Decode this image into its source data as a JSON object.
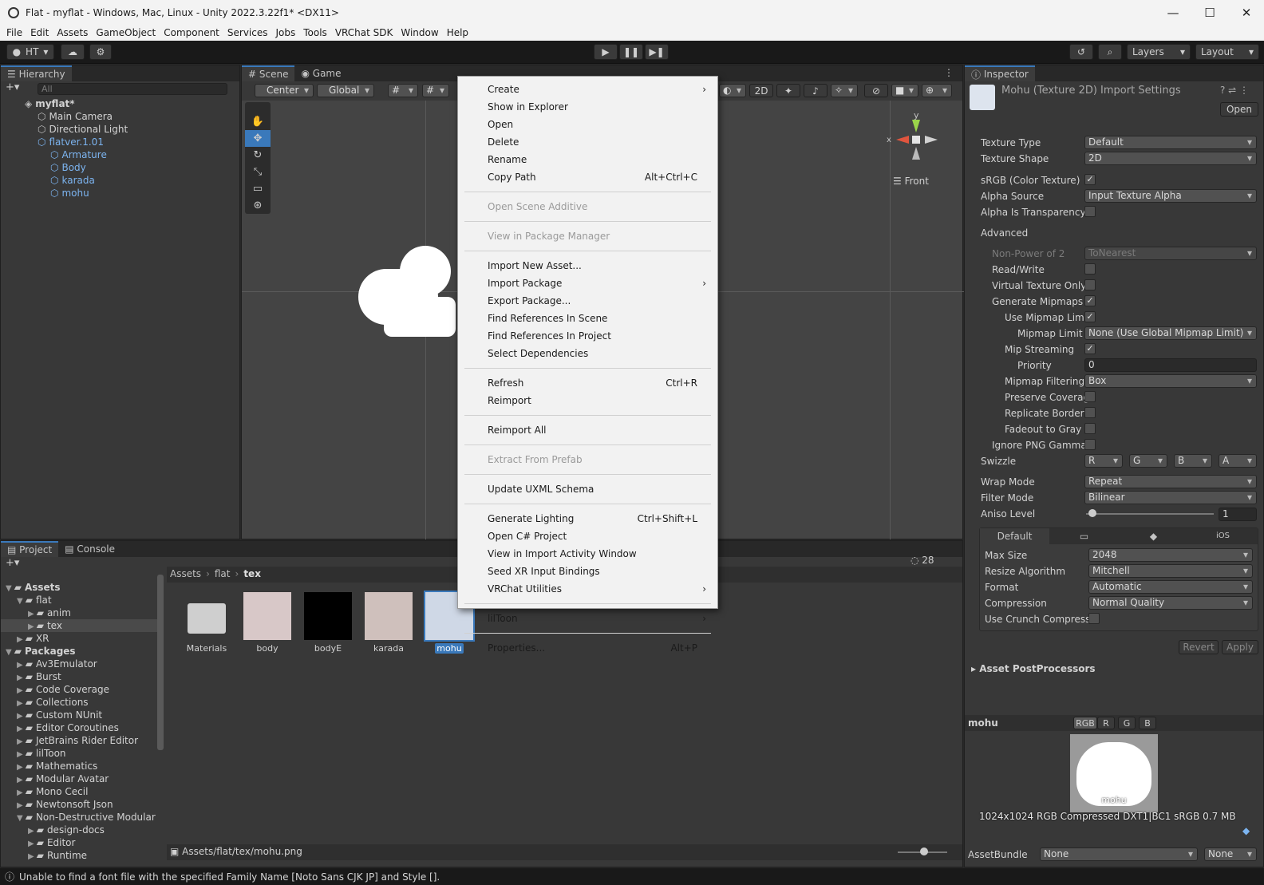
{
  "window": {
    "title": "Flat - myflat - Windows, Mac, Linux - Unity 2022.3.22f1* <DX11>"
  },
  "menubar": [
    "File",
    "Edit",
    "Assets",
    "GameObject",
    "Component",
    "Services",
    "Jobs",
    "Tools",
    "VRChat SDK",
    "Window",
    "Help"
  ],
  "toolbar": {
    "account": "HT",
    "layers": "Layers",
    "layout": "Layout"
  },
  "hierarchy": {
    "tab": "Hierarchy",
    "search_placeholder": "All",
    "items": [
      {
        "label": "myflat*",
        "depth": 0,
        "bold": true
      },
      {
        "label": "Main Camera",
        "depth": 1
      },
      {
        "label": "Directional Light",
        "depth": 1
      },
      {
        "label": "flatver.1.01",
        "depth": 1,
        "blue": true
      },
      {
        "label": "Armature",
        "depth": 2,
        "blue": true
      },
      {
        "label": "Body",
        "depth": 2,
        "blue": true
      },
      {
        "label": "karada",
        "depth": 2,
        "blue": true
      },
      {
        "label": "mohu",
        "depth": 2,
        "blue": true
      }
    ]
  },
  "scene": {
    "tab_scene": "Scene",
    "tab_game": "Game",
    "pivot": "Center",
    "space": "Global",
    "mode2d": "2D",
    "axis_y": "y",
    "axis_x": "x",
    "view": "Front"
  },
  "context_menu": [
    {
      "label": "Create",
      "arrow": true
    },
    {
      "label": "Show in Explorer"
    },
    {
      "label": "Open"
    },
    {
      "label": "Delete"
    },
    {
      "label": "Rename"
    },
    {
      "label": "Copy Path",
      "shortcut": "Alt+Ctrl+C"
    },
    {
      "sep": true
    },
    {
      "label": "Open Scene Additive",
      "disabled": true
    },
    {
      "sep": true
    },
    {
      "label": "View in Package Manager",
      "disabled": true
    },
    {
      "sep": true
    },
    {
      "label": "Import New Asset..."
    },
    {
      "label": "Import Package",
      "arrow": true
    },
    {
      "label": "Export Package..."
    },
    {
      "label": "Find References In Scene"
    },
    {
      "label": "Find References In Project"
    },
    {
      "label": "Select Dependencies"
    },
    {
      "sep": true
    },
    {
      "label": "Refresh",
      "shortcut": "Ctrl+R"
    },
    {
      "label": "Reimport"
    },
    {
      "sep": true
    },
    {
      "label": "Reimport All"
    },
    {
      "sep": true
    },
    {
      "label": "Extract From Prefab",
      "disabled": true
    },
    {
      "sep": true
    },
    {
      "label": "Update UXML Schema"
    },
    {
      "sep": true
    },
    {
      "label": "Generate Lighting",
      "shortcut": "Ctrl+Shift+L"
    },
    {
      "label": "Open C# Project"
    },
    {
      "label": "View in Import Activity Window"
    },
    {
      "label": "Seed XR Input Bindings"
    },
    {
      "label": "VRChat Utilities",
      "arrow": true
    },
    {
      "sep": true
    },
    {
      "label": "lilToon",
      "arrow": true
    },
    {
      "sep": true
    },
    {
      "label": "Properties...",
      "shortcut": "Alt+P"
    }
  ],
  "project": {
    "tab_project": "Project",
    "tab_console": "Console",
    "hidden_count": "28",
    "breadcrumb": [
      "Assets",
      "flat",
      "tex"
    ],
    "tree": [
      {
        "label": "Assets",
        "depth": 0,
        "bold": true,
        "open": true
      },
      {
        "label": "flat",
        "depth": 1,
        "open": true
      },
      {
        "label": "anim",
        "depth": 2
      },
      {
        "label": "tex",
        "depth": 2,
        "selected": true
      },
      {
        "label": "XR",
        "depth": 1
      },
      {
        "label": "Packages",
        "depth": 0,
        "bold": true,
        "open": true
      },
      {
        "label": "Av3Emulator",
        "depth": 1
      },
      {
        "label": "Burst",
        "depth": 1
      },
      {
        "label": "Code Coverage",
        "depth": 1
      },
      {
        "label": "Collections",
        "depth": 1
      },
      {
        "label": "Custom NUnit",
        "depth": 1
      },
      {
        "label": "Editor Coroutines",
        "depth": 1
      },
      {
        "label": "JetBrains Rider Editor",
        "depth": 1
      },
      {
        "label": "lilToon",
        "depth": 1
      },
      {
        "label": "Mathematics",
        "depth": 1
      },
      {
        "label": "Modular Avatar",
        "depth": 1
      },
      {
        "label": "Mono Cecil",
        "depth": 1
      },
      {
        "label": "Newtonsoft Json",
        "depth": 1
      },
      {
        "label": "Non-Destructive Modular",
        "depth": 1,
        "open": true
      },
      {
        "label": "design-docs",
        "depth": 2
      },
      {
        "label": "Editor",
        "depth": 2
      },
      {
        "label": "Runtime",
        "depth": 2
      }
    ],
    "assets": [
      "Materials",
      "body",
      "bodyE",
      "karada",
      "mohu"
    ],
    "path": "Assets/flat/tex/mohu.png"
  },
  "inspector": {
    "tab": "Inspector",
    "title": "Mohu (Texture 2D) Import Settings",
    "open": "Open",
    "rows": [
      {
        "label": "Texture Type",
        "dd": "Default"
      },
      {
        "label": "Texture Shape",
        "dd": "2D"
      },
      {
        "label": "sRGB (Color Texture)",
        "cb": true
      },
      {
        "label": "Alpha Source",
        "dd": "Input Texture Alpha"
      },
      {
        "label": "Alpha Is Transparency",
        "cb": false
      },
      {
        "label": "Advanced",
        "fold": true
      },
      {
        "label": "Non-Power of 2",
        "dd": "ToNearest",
        "dim": true
      },
      {
        "label": "Read/Write",
        "cb": false
      },
      {
        "label": "Virtual Texture Only",
        "cb": false
      },
      {
        "label": "Generate Mipmaps",
        "cb": true
      },
      {
        "label": "Use Mipmap Limi",
        "cb": true
      },
      {
        "label": "Mipmap Limit (",
        "dd": "None (Use Global Mipmap Limit)"
      },
      {
        "label": "Mip Streaming",
        "cb": true
      },
      {
        "label": "Priority",
        "field": "0"
      },
      {
        "label": "Mipmap Filtering",
        "dd": "Box"
      },
      {
        "label": "Preserve Coverag",
        "cb": false
      },
      {
        "label": "Replicate Border",
        "cb": false
      },
      {
        "label": "Fadeout to Gray",
        "cb": false
      },
      {
        "label": "Ignore PNG Gamma",
        "cb": false
      },
      {
        "label": "Swizzle"
      }
    ],
    "swizzle": [
      "R",
      "G",
      "B",
      "A"
    ],
    "wrap_mode": {
      "label": "Wrap Mode",
      "value": "Repeat"
    },
    "filter_mode": {
      "label": "Filter Mode",
      "value": "Bilinear"
    },
    "aniso": {
      "label": "Aniso Level",
      "value": "1",
      "level": 0.05
    },
    "platform": {
      "default": "Default",
      "ios": "iOS",
      "rows": [
        {
          "label": "Max Size",
          "dd": "2048"
        },
        {
          "label": "Resize Algorithm",
          "dd": "Mitchell"
        },
        {
          "label": "Format",
          "dd": "Automatic"
        },
        {
          "label": "Compression",
          "dd": "Normal Quality"
        },
        {
          "label": "Use Crunch Compressi",
          "cb": false
        }
      ]
    },
    "revert": "Revert",
    "apply": "Apply",
    "postprocessors": "Asset PostProcessors",
    "preview": {
      "name": "mohu",
      "channels": [
        "RGB",
        "R",
        "G",
        "B"
      ],
      "caption": "mohu",
      "info": "1024x1024  RGB Compressed DXT1|BC1 sRGB  0.7 MB"
    },
    "assetbundle": {
      "label": "AssetBundle",
      "value": "None",
      "variant": "None"
    }
  },
  "status": "Unable to find a font file with the specified Family Name [Noto Sans CJK JP] and Style []."
}
